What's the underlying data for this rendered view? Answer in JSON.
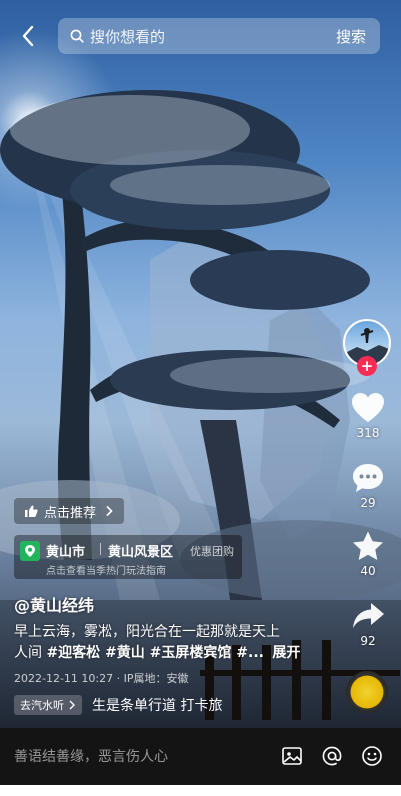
{
  "search": {
    "placeholder": "搜你想看的",
    "button": "搜索"
  },
  "rail": {
    "likes": "318",
    "comments": "29",
    "favorites": "40",
    "shares": "92",
    "follow": "+"
  },
  "recommend": {
    "label": "点击推荐"
  },
  "poi": {
    "city": "黄山市",
    "area": "黄山风景区",
    "tag": "优惠团购",
    "subtitle": "点击查看当季热门玩法指南"
  },
  "post": {
    "author": "@黄山经纬",
    "caption_line1": "早上云海，雾凇，阳光合在一起那就是天上",
    "caption_line2_start": "人间 ",
    "caption_tags": "#迎客松 #黄山 #玉屏楼宾馆 #...",
    "caption_more": "展开",
    "meta": "2022-12-11 10:27 · IP属地：安徽"
  },
  "music": {
    "chip": "去汽水听",
    "title": "生是条单行道   打卡旅"
  },
  "comment": {
    "placeholder": "善语结善缘，恶言伤人心"
  }
}
